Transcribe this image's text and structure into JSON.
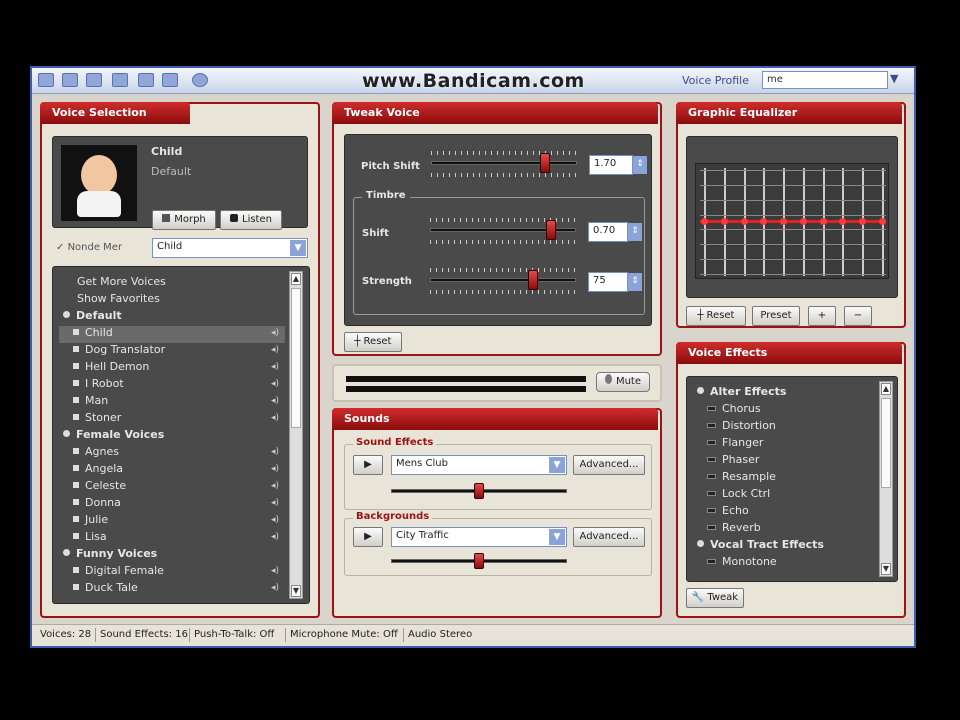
{
  "window": {
    "watermark": "www.Bandicam.com",
    "voice_profile_label": "Voice Profile",
    "voice_profile_value": "me"
  },
  "voice_selection": {
    "title": "Voice Selection",
    "voice_name": "Child",
    "voice_desc": "Default",
    "morph_label": "Morph",
    "listen_label": "Listen",
    "checkbox_label": "Nonde Mer",
    "combo_value": "Child",
    "list": [
      {
        "label": "Get More Voices",
        "type": "link"
      },
      {
        "label": "Show Favorites",
        "type": "link"
      },
      {
        "label": "Default",
        "type": "cat"
      },
      {
        "label": "Child",
        "type": "item",
        "selected": true
      },
      {
        "label": "Dog Translator",
        "type": "item"
      },
      {
        "label": "Hell Demon",
        "type": "item"
      },
      {
        "label": "I Robot",
        "type": "item"
      },
      {
        "label": "Man",
        "type": "item"
      },
      {
        "label": "Stoner",
        "type": "item"
      },
      {
        "label": "Female Voices",
        "type": "cat"
      },
      {
        "label": "Agnes",
        "type": "item"
      },
      {
        "label": "Angela",
        "type": "item"
      },
      {
        "label": "Celeste",
        "type": "item"
      },
      {
        "label": "Donna",
        "type": "item"
      },
      {
        "label": "Julie",
        "type": "item"
      },
      {
        "label": "Lisa",
        "type": "item"
      },
      {
        "label": "Funny Voices",
        "type": "cat"
      },
      {
        "label": "Digital Female",
        "type": "item"
      },
      {
        "label": "Duck Tale",
        "type": "item"
      }
    ]
  },
  "tweak_voice": {
    "title": "Tweak Voice",
    "pitch_label": "Pitch Shift",
    "pitch_value": "1.70",
    "pitch_level": 0.8,
    "timbre_label": "Timbre",
    "shift_label": "Shift",
    "shift_value": "0.70",
    "shift_level": 0.85,
    "strength_label": "Strength",
    "strength_value": "75",
    "strength_level": 0.72,
    "reset_label": "Reset",
    "mute_label": "Mute"
  },
  "graphic_equalizer": {
    "title": "Graphic Equalizer",
    "reset_label": "Reset",
    "preset_label": "Preset",
    "plus_label": "+",
    "minus_label": "−"
  },
  "sounds": {
    "title": "Sounds",
    "sound_effects_label": "Sound Effects",
    "sound_effects_value": "Mens Club",
    "sound_effects_advanced": "Advanced...",
    "sound_effects_level": 0.5,
    "backgrounds_label": "Backgrounds",
    "backgrounds_value": "City Traffic",
    "backgrounds_advanced": "Advanced...",
    "backgrounds_level": 0.5
  },
  "voice_effects": {
    "title": "Voice Effects",
    "tweak_label": "Tweak",
    "list": [
      {
        "label": "Alter Effects",
        "type": "cat"
      },
      {
        "label": "Chorus",
        "type": "item"
      },
      {
        "label": "Distortion",
        "type": "item"
      },
      {
        "label": "Flanger",
        "type": "item"
      },
      {
        "label": "Phaser",
        "type": "item"
      },
      {
        "label": "Resample",
        "type": "item"
      },
      {
        "label": "Lock Ctrl",
        "type": "item"
      },
      {
        "label": "Echo",
        "type": "item"
      },
      {
        "label": "Reverb",
        "type": "item"
      },
      {
        "label": "Vocal Tract Effects",
        "type": "cat"
      },
      {
        "label": "Monotone",
        "type": "item"
      }
    ]
  },
  "statusbar": {
    "items": [
      "Voices: 28",
      "Sound Effects: 16",
      "Push-To-Talk: Off",
      "Microphone Mute: Off",
      "Audio Stereo"
    ]
  }
}
